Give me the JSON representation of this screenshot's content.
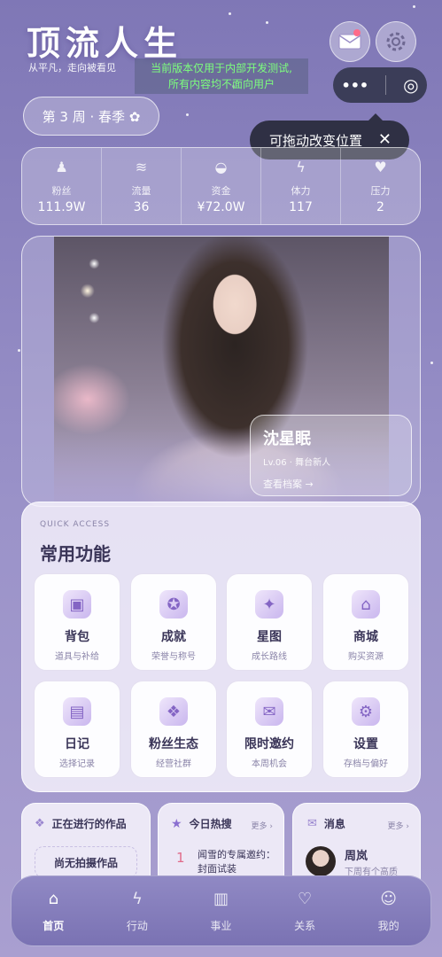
{
  "app": {
    "title": "顶流人生",
    "subtitle": "从平凡，走向被看见"
  },
  "dev_notice": {
    "line1": "当前版本仅用于内部开发测试,",
    "line2": "所有内容均不面向用户"
  },
  "tooltip": {
    "text": "可拖动改变位置",
    "close": "✕"
  },
  "capsule": {
    "menu": "•••",
    "target": "◎"
  },
  "week": {
    "label": "第 3 周 · 春季 ✿"
  },
  "stats": [
    {
      "label": "粉丝",
      "value": "111.9W",
      "icon": "fans-icon"
    },
    {
      "label": "流量",
      "value": "36",
      "icon": "traffic-icon"
    },
    {
      "label": "资金",
      "value": "¥72.0W",
      "icon": "money-icon"
    },
    {
      "label": "体力",
      "value": "117",
      "icon": "energy-icon"
    },
    {
      "label": "压力",
      "value": "2",
      "icon": "pressure-icon"
    }
  ],
  "character": {
    "name": "沈星眠",
    "level": "Lv.06 · 舞台新人",
    "link": "查看档案 →"
  },
  "quick": {
    "eyebrow": "QUICK ACCESS",
    "title": "常用功能",
    "items": [
      {
        "name": "背包",
        "desc": "道具与补给",
        "icon": "backpack-icon",
        "glyph": "▣"
      },
      {
        "name": "成就",
        "desc": "荣誉与称号",
        "icon": "achievement-icon",
        "glyph": "✪"
      },
      {
        "name": "星图",
        "desc": "成长路线",
        "icon": "star-map-icon",
        "glyph": "✦"
      },
      {
        "name": "商城",
        "desc": "购买资源",
        "icon": "shop-icon",
        "glyph": "⌂"
      },
      {
        "name": "日记",
        "desc": "选择记录",
        "icon": "diary-icon",
        "glyph": "▤"
      },
      {
        "name": "粉丝生态",
        "desc": "经营社群",
        "icon": "fan-community-icon",
        "glyph": "❖"
      },
      {
        "name": "限时邀约",
        "desc": "本周机会",
        "icon": "invitation-icon",
        "glyph": "✉"
      },
      {
        "name": "设置",
        "desc": "存档与偏好",
        "icon": "settings-icon",
        "glyph": "⚙"
      }
    ]
  },
  "works": {
    "title": "正在进行的作品",
    "empty": "尚无拍摄作品"
  },
  "hot": {
    "title": "今日热搜",
    "more": "更多 ›",
    "rank": "1",
    "text": "闻雪的专属邀约：封面试装"
  },
  "messages": {
    "title": "消息",
    "more": "更多 ›",
    "sender": "周岚",
    "preview": "下周有个高质"
  },
  "nav": [
    {
      "label": "首页",
      "icon": "home-icon",
      "glyph": "⌂",
      "active": true
    },
    {
      "label": "行动",
      "icon": "action-icon",
      "glyph": "ϟ",
      "active": false
    },
    {
      "label": "事业",
      "icon": "career-icon",
      "glyph": "▥",
      "active": false
    },
    {
      "label": "关系",
      "icon": "relation-icon",
      "glyph": "♡",
      "active": false
    },
    {
      "label": "我的",
      "icon": "profile-icon",
      "glyph": "☺",
      "active": false
    }
  ]
}
